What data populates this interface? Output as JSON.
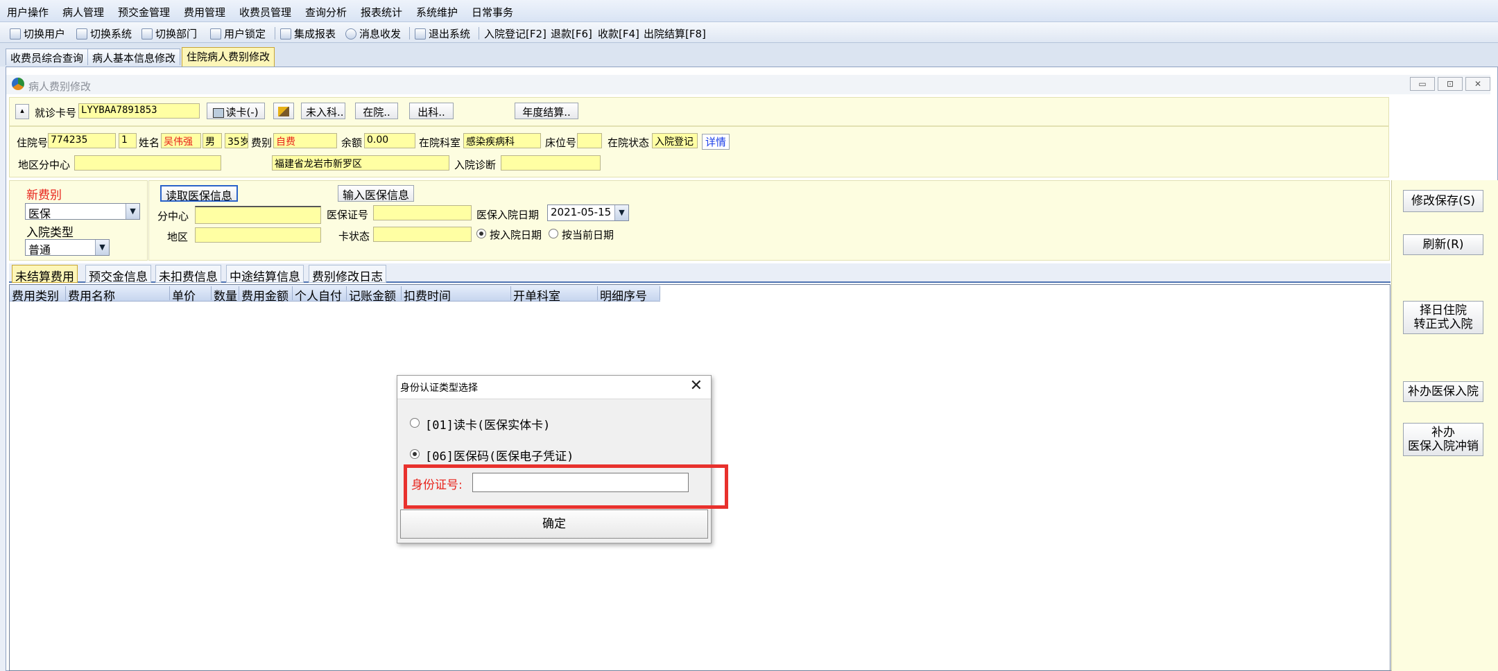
{
  "menu": [
    "用户操作",
    "病人管理",
    "预交金管理",
    "费用管理",
    "收费员管理",
    "查询分析",
    "报表统计",
    "系统维护",
    "日常事务"
  ],
  "toolbar": {
    "switch_user": "切换用户",
    "switch_system": "切换系统",
    "switch_dept": "切换部门",
    "lock_user": "用户锁定",
    "integrated_report": "集成报表",
    "messages": "消息收发",
    "exit": "退出系统",
    "admit_register": "入院登记[F2]",
    "refund": "退款[F6]",
    "collect": "收款[F4]",
    "discharge_settle": "出院结算[F8]"
  },
  "doc_tabs": [
    "收费员综合查询",
    "病人基本信息修改",
    "住院病人费别修改"
  ],
  "window": {
    "title": "病人费别修改",
    "minimize": "▭",
    "restore": "⊡",
    "close": "✕"
  },
  "card": {
    "label": "就诊卡号",
    "value": "LYYBAA7891853",
    "read_card": "读卡(-)",
    "not_admitted": "未入科..",
    "in_hospital": "在院..",
    "out_dept": "出科..",
    "annual_settle": "年度结算.."
  },
  "patient": {
    "admission_no_label": "住院号",
    "admission_no": "774235",
    "times": "1",
    "name_label": "姓名",
    "name": "吴伟强",
    "gender": "男",
    "age": "35岁",
    "fee_type_label": "费别",
    "fee_type": "自费",
    "balance_label": "余额",
    "balance": "0.00",
    "dept_label": "在院科室",
    "dept": "感染疾病科",
    "bed_label": "床位号",
    "bed": "",
    "status_label": "在院状态",
    "status": "入院登记",
    "detail": "详情",
    "region_center_label": "地区分中心",
    "region_center": "",
    "address": "福建省龙岩市新罗区",
    "diagnosis_label": "入院诊断",
    "diagnosis": ""
  },
  "new_fee": {
    "label": "新费别",
    "value": "医保",
    "admit_type_label": "入院类型",
    "admit_type": "普通"
  },
  "medi": {
    "read_btn": "读取医保信息",
    "input_btn": "输入医保信息",
    "center_label": "分中心",
    "cert_label": "医保证号",
    "date_label": "医保入院日期",
    "date": "2021-05-15",
    "area_label": "地区",
    "card_status_label": "卡状态",
    "radio_by_admit": "按入院日期",
    "radio_by_current": "按当前日期"
  },
  "right_buttons": {
    "save": "修改保存(S)",
    "refresh": "刷新(R)",
    "select_day_1": "择日住院",
    "select_day_2": "转正式入院",
    "supplement": "补办医保入院",
    "supp_cancel_1": "补办",
    "supp_cancel_2": "医保入院冲销"
  },
  "sub_tabs": [
    "未结算费用",
    "预交金信息",
    "未扣费信息",
    "中途结算信息",
    "费别修改日志"
  ],
  "grid_headers": [
    "费用类别",
    "费用名称",
    "单价",
    "数量",
    "费用金额",
    "个人自付",
    "记账金额",
    "扣费时间",
    "开单科室",
    "明细序号"
  ],
  "dialog": {
    "title": "身份认证类型选择",
    "close": "✕",
    "option1": "[01]读卡(医保实体卡)",
    "option2": "[06]医保码(医保电子凭证)",
    "selected": "option2",
    "id_label": "身份证号:",
    "id_value": "",
    "ok": "确定"
  },
  "colors": {
    "field_yellow": "#ffffa3",
    "panel_yellow": "#fdfde0",
    "highlight_red": "#e8312d",
    "label_red": "#e8231b"
  }
}
